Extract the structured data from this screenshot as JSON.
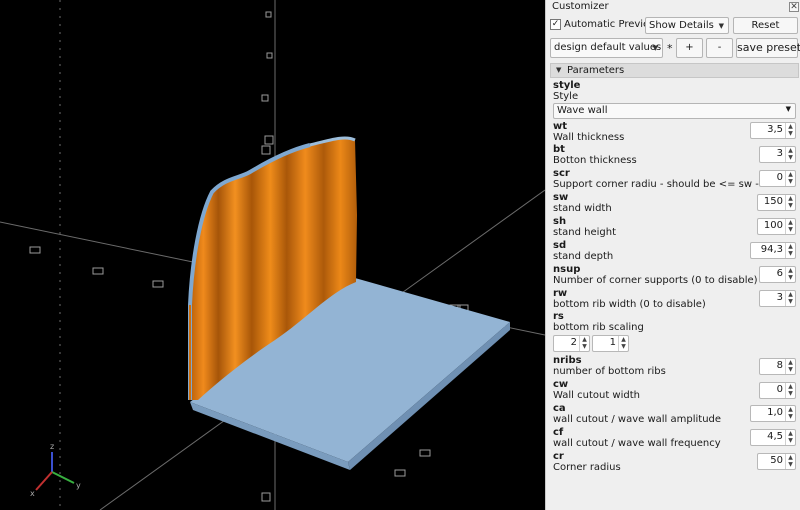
{
  "customizer": {
    "title": "Customizer",
    "close_glyph": "✕",
    "auto_preview_checked": "✓",
    "auto_preview_label": "Automatic Preview",
    "show_details": "Show Details",
    "reset_label": "Reset",
    "preset": "design default values",
    "asterisk": "*",
    "add_label": "+",
    "remove_label": "-",
    "save_preset_label": "save preset"
  },
  "section": {
    "label": "Parameters",
    "toggle_glyph": "▼"
  },
  "params": {
    "style": {
      "name": "style",
      "desc": "Style",
      "value": "Wave wall"
    },
    "wt": {
      "name": "wt",
      "desc": "Wall thickness",
      "value": "3,5"
    },
    "bt": {
      "name": "bt",
      "desc": "Botton thickness",
      "value": "3"
    },
    "scr": {
      "name": "scr",
      "desc": "Support corner radiu - should be <= sw - wt",
      "value": "0"
    },
    "sw": {
      "name": "sw",
      "desc": "stand width",
      "value": "150"
    },
    "sh": {
      "name": "sh",
      "desc": "stand height",
      "value": "100"
    },
    "sd": {
      "name": "sd",
      "desc": "stand depth",
      "value": "94,3"
    },
    "nsup": {
      "name": "nsup",
      "desc": "Number of corner supports (0 to disable)",
      "value": "6"
    },
    "rw": {
      "name": "rw",
      "desc": "bottom rib width (0 to disable)",
      "value": "3"
    },
    "rs": {
      "name": "rs",
      "desc": "bottom rib scaling",
      "value_x": "2",
      "value_y": "1"
    },
    "nribs": {
      "name": "nribs",
      "desc": "number of bottom ribs",
      "value": "8"
    },
    "cw": {
      "name": "cw",
      "desc": "Wall cutout width",
      "value": "0"
    },
    "ca": {
      "name": "ca",
      "desc": "wall cutout / wave wall amplitude",
      "value": "1,0"
    },
    "cf": {
      "name": "cf",
      "desc": "wall cutout / wave wall frequency",
      "value": "4,5"
    },
    "cr": {
      "name": "cr",
      "desc": "Corner radius",
      "value": "50"
    }
  },
  "axes": {
    "x": "x",
    "y": "y",
    "z": "z"
  },
  "colors": {
    "viewport_bg": "#000000",
    "wall_orange": "#e07a10",
    "wall_edge": "#7fa8d0",
    "base_blue": "#93b4d4"
  },
  "icons": [
    "close-icon",
    "checkbox",
    "chevron-down-icon",
    "spin-arrows-icon",
    "collapse-triangle-icon"
  ]
}
